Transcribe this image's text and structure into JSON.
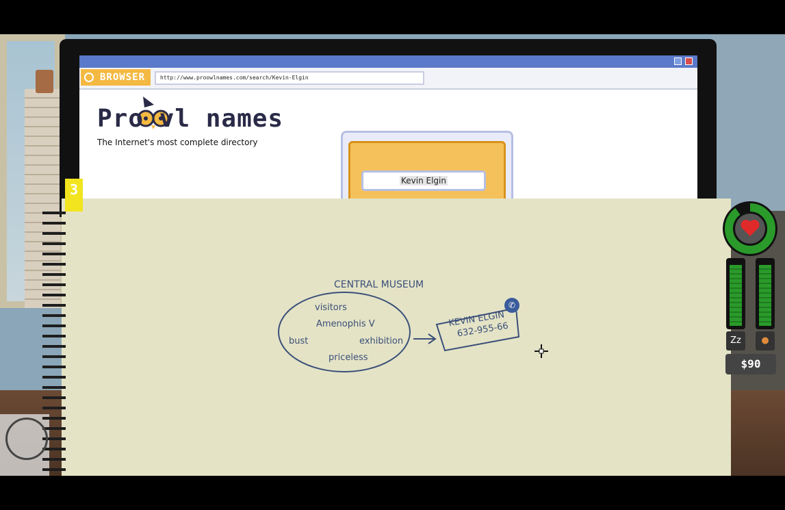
{
  "browser": {
    "tab_label": "BROWSER",
    "url": "http://www.proowlnames.com/search/Kevin-Elgin"
  },
  "site": {
    "logo_text": "Pro   vl names",
    "tagline": "The Internet's most complete directory",
    "search_value": "Kevin Elgin"
  },
  "notebook": {
    "tab_number": "3",
    "heading": "CENTRAL MUSEUM",
    "keywords": {
      "visitors": "visitors",
      "amenophis": "Amenophis V",
      "bust": "bust",
      "exhibition": "exhibition",
      "priceless": "priceless"
    },
    "contact": {
      "name": "KEVIN ELGIN",
      "phone": "632-955-66"
    }
  },
  "hud": {
    "money": "$90",
    "health_level": 0.9,
    "sleep_level": 0.95,
    "food_level": 0.95
  },
  "colors": {
    "ink": "#3a4f78",
    "accent": "#f4b942",
    "health": "#2a9a2a"
  }
}
